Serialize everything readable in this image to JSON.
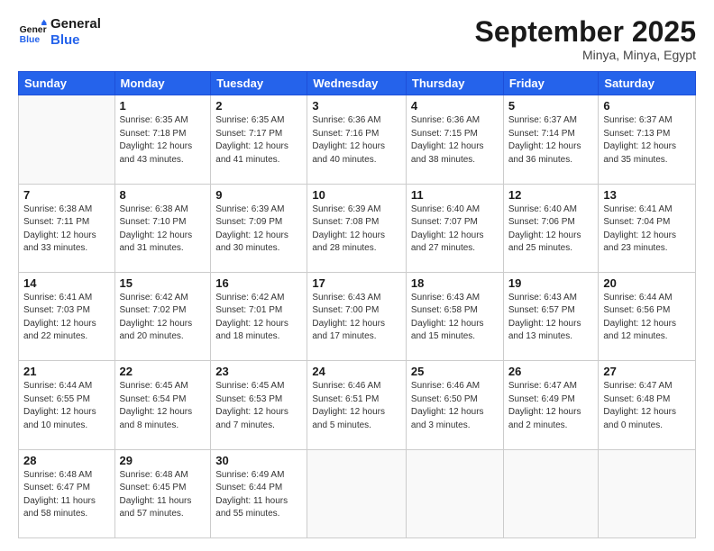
{
  "logo": {
    "line1": "General",
    "line2": "Blue"
  },
  "header": {
    "month": "September 2025",
    "location": "Minya, Minya, Egypt"
  },
  "weekdays": [
    "Sunday",
    "Monday",
    "Tuesday",
    "Wednesday",
    "Thursday",
    "Friday",
    "Saturday"
  ],
  "weeks": [
    [
      {
        "day": "",
        "info": ""
      },
      {
        "day": "1",
        "info": "Sunrise: 6:35 AM\nSunset: 7:18 PM\nDaylight: 12 hours\nand 43 minutes."
      },
      {
        "day": "2",
        "info": "Sunrise: 6:35 AM\nSunset: 7:17 PM\nDaylight: 12 hours\nand 41 minutes."
      },
      {
        "day": "3",
        "info": "Sunrise: 6:36 AM\nSunset: 7:16 PM\nDaylight: 12 hours\nand 40 minutes."
      },
      {
        "day": "4",
        "info": "Sunrise: 6:36 AM\nSunset: 7:15 PM\nDaylight: 12 hours\nand 38 minutes."
      },
      {
        "day": "5",
        "info": "Sunrise: 6:37 AM\nSunset: 7:14 PM\nDaylight: 12 hours\nand 36 minutes."
      },
      {
        "day": "6",
        "info": "Sunrise: 6:37 AM\nSunset: 7:13 PM\nDaylight: 12 hours\nand 35 minutes."
      }
    ],
    [
      {
        "day": "7",
        "info": "Sunrise: 6:38 AM\nSunset: 7:11 PM\nDaylight: 12 hours\nand 33 minutes."
      },
      {
        "day": "8",
        "info": "Sunrise: 6:38 AM\nSunset: 7:10 PM\nDaylight: 12 hours\nand 31 minutes."
      },
      {
        "day": "9",
        "info": "Sunrise: 6:39 AM\nSunset: 7:09 PM\nDaylight: 12 hours\nand 30 minutes."
      },
      {
        "day": "10",
        "info": "Sunrise: 6:39 AM\nSunset: 7:08 PM\nDaylight: 12 hours\nand 28 minutes."
      },
      {
        "day": "11",
        "info": "Sunrise: 6:40 AM\nSunset: 7:07 PM\nDaylight: 12 hours\nand 27 minutes."
      },
      {
        "day": "12",
        "info": "Sunrise: 6:40 AM\nSunset: 7:06 PM\nDaylight: 12 hours\nand 25 minutes."
      },
      {
        "day": "13",
        "info": "Sunrise: 6:41 AM\nSunset: 7:04 PM\nDaylight: 12 hours\nand 23 minutes."
      }
    ],
    [
      {
        "day": "14",
        "info": "Sunrise: 6:41 AM\nSunset: 7:03 PM\nDaylight: 12 hours\nand 22 minutes."
      },
      {
        "day": "15",
        "info": "Sunrise: 6:42 AM\nSunset: 7:02 PM\nDaylight: 12 hours\nand 20 minutes."
      },
      {
        "day": "16",
        "info": "Sunrise: 6:42 AM\nSunset: 7:01 PM\nDaylight: 12 hours\nand 18 minutes."
      },
      {
        "day": "17",
        "info": "Sunrise: 6:43 AM\nSunset: 7:00 PM\nDaylight: 12 hours\nand 17 minutes."
      },
      {
        "day": "18",
        "info": "Sunrise: 6:43 AM\nSunset: 6:58 PM\nDaylight: 12 hours\nand 15 minutes."
      },
      {
        "day": "19",
        "info": "Sunrise: 6:43 AM\nSunset: 6:57 PM\nDaylight: 12 hours\nand 13 minutes."
      },
      {
        "day": "20",
        "info": "Sunrise: 6:44 AM\nSunset: 6:56 PM\nDaylight: 12 hours\nand 12 minutes."
      }
    ],
    [
      {
        "day": "21",
        "info": "Sunrise: 6:44 AM\nSunset: 6:55 PM\nDaylight: 12 hours\nand 10 minutes."
      },
      {
        "day": "22",
        "info": "Sunrise: 6:45 AM\nSunset: 6:54 PM\nDaylight: 12 hours\nand 8 minutes."
      },
      {
        "day": "23",
        "info": "Sunrise: 6:45 AM\nSunset: 6:53 PM\nDaylight: 12 hours\nand 7 minutes."
      },
      {
        "day": "24",
        "info": "Sunrise: 6:46 AM\nSunset: 6:51 PM\nDaylight: 12 hours\nand 5 minutes."
      },
      {
        "day": "25",
        "info": "Sunrise: 6:46 AM\nSunset: 6:50 PM\nDaylight: 12 hours\nand 3 minutes."
      },
      {
        "day": "26",
        "info": "Sunrise: 6:47 AM\nSunset: 6:49 PM\nDaylight: 12 hours\nand 2 minutes."
      },
      {
        "day": "27",
        "info": "Sunrise: 6:47 AM\nSunset: 6:48 PM\nDaylight: 12 hours\nand 0 minutes."
      }
    ],
    [
      {
        "day": "28",
        "info": "Sunrise: 6:48 AM\nSunset: 6:47 PM\nDaylight: 11 hours\nand 58 minutes."
      },
      {
        "day": "29",
        "info": "Sunrise: 6:48 AM\nSunset: 6:45 PM\nDaylight: 11 hours\nand 57 minutes."
      },
      {
        "day": "30",
        "info": "Sunrise: 6:49 AM\nSunset: 6:44 PM\nDaylight: 11 hours\nand 55 minutes."
      },
      {
        "day": "",
        "info": ""
      },
      {
        "day": "",
        "info": ""
      },
      {
        "day": "",
        "info": ""
      },
      {
        "day": "",
        "info": ""
      }
    ]
  ]
}
